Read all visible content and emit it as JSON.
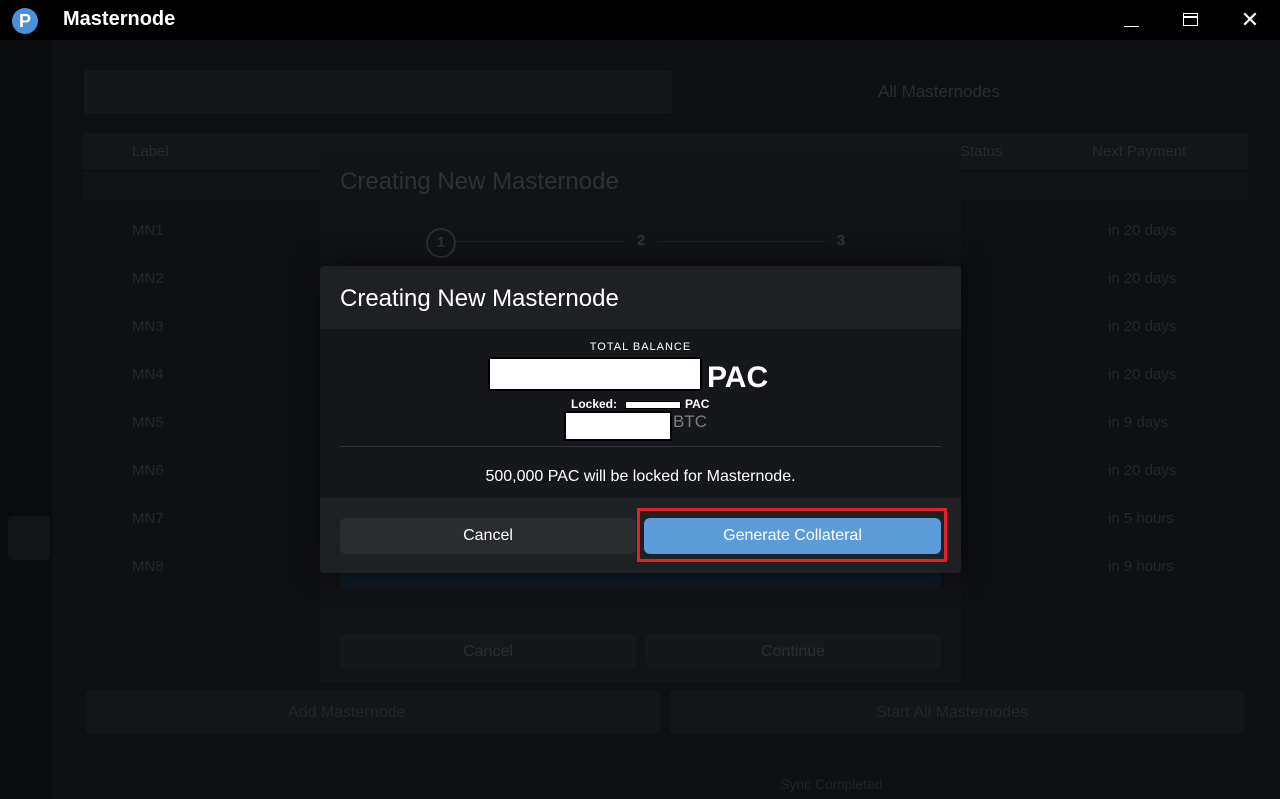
{
  "window": {
    "title": "Masternode",
    "logo_letter": "P",
    "minimize_label": "Minimize",
    "maximize_label": "Maximize",
    "close_glyph": "✕"
  },
  "background": {
    "all_masternodes": "All Masternodes",
    "table_headers": [
      "Label",
      "Status",
      "Next Payment"
    ],
    "rows": [
      "MN1",
      "MN2",
      "MN3",
      "MN4",
      "MN5",
      "MN6",
      "MN7",
      "MN8"
    ],
    "next_payments": [
      "in 20 days",
      "in 20 days",
      "in 20 days",
      "in 20 days",
      "in 9 days",
      "in 20 days",
      "in 5 hours",
      "in 9 hours"
    ],
    "bottom_left_button": "Add Masternode",
    "bottom_right_button": "Start All Masternodes",
    "status_sync": "Sync Completed"
  },
  "under_dialog": {
    "title": "Creating New Masternode",
    "steps": [
      "1",
      "2",
      "3"
    ],
    "cancel_label": "Cancel",
    "continue_label": "Continue"
  },
  "dialog": {
    "title": "Creating New Masternode",
    "total_balance_label": "TOTAL BALANCE",
    "balance_unit": "PAC",
    "locked_label": "Locked:",
    "locked_unit": "PAC",
    "btc_unit": "BTC",
    "lock_message": "500,000 PAC will be locked for Masternode.",
    "cancel_label": "Cancel",
    "generate_label": "Generate Collateral",
    "highlight_color": "#e0202b",
    "accent_color": "#5b9bd8"
  }
}
